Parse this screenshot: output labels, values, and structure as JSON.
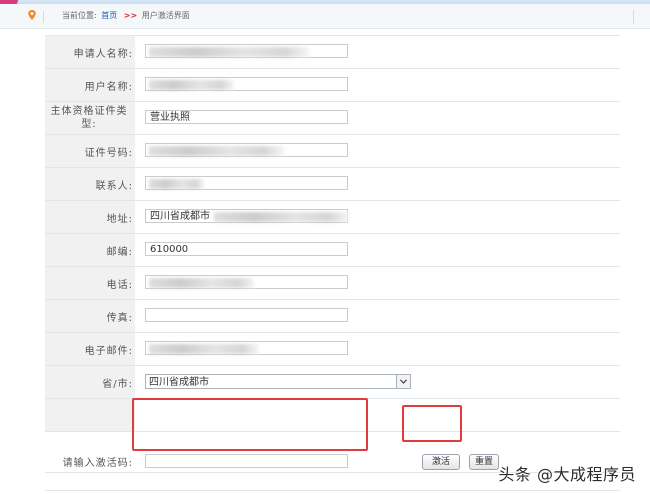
{
  "breadcrumb": {
    "prefix": "当前位置:",
    "home": "首页",
    "arrow": ">>",
    "current": "用户激活界面"
  },
  "form": {
    "applicant_name": {
      "label": "申请人名称:",
      "value": ""
    },
    "username": {
      "label": "用户名称:",
      "value": ""
    },
    "cert_type": {
      "label": "主体资格证件类型:",
      "value": "营业执照"
    },
    "cert_number": {
      "label": "证件号码:",
      "value": ""
    },
    "contact": {
      "label": "联系人:",
      "value": ""
    },
    "address": {
      "label": "地址:",
      "value": "四川省成都市"
    },
    "postcode": {
      "label": "邮编:",
      "value": "610000"
    },
    "phone": {
      "label": "电话:",
      "value": ""
    },
    "fax": {
      "label": "传真:",
      "value": ""
    },
    "email": {
      "label": "电子邮件:",
      "value": ""
    },
    "province_city": {
      "label": "省/市:",
      "value": "四川省成都市"
    },
    "activation_code": {
      "label": "请输入激活码:",
      "value": ""
    }
  },
  "buttons": {
    "activate": "激活",
    "reset": "重置"
  },
  "watermark": "头条 @大成程序员",
  "colors": {
    "highlight": "#e23b3b",
    "link": "#1f5aa6",
    "label_bg": "#f1f1f1"
  }
}
